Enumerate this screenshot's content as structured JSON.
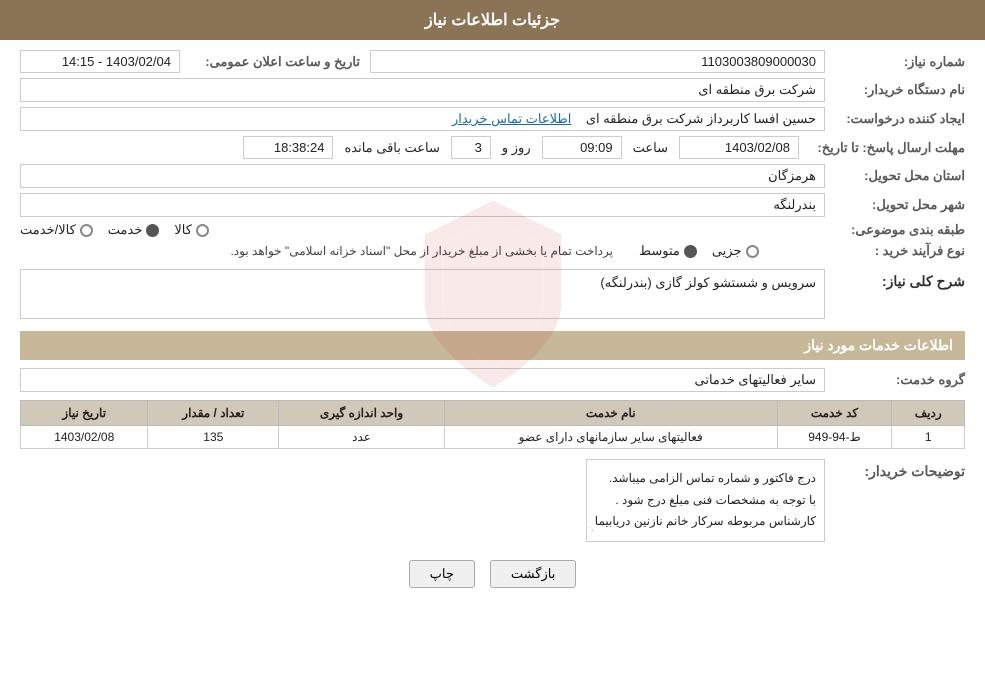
{
  "header": {
    "title": "جزئیات اطلاعات نیاز"
  },
  "fields": {
    "need_number_label": "شماره نیاز:",
    "need_number_value": "1103003809000030",
    "buyer_org_label": "نام دستگاه خریدار:",
    "buyer_org_value": "شرکت برق منطقه ای",
    "creator_label": "ایجاد کننده درخواست:",
    "creator_value": "حسین افسا کاربرداز شرکت برق منطقه ای",
    "creator_link": "اطلاعات تماس خریدار",
    "response_deadline_label": "مهلت ارسال پاسخ: تا تاریخ:",
    "response_date": "1403/02/08",
    "response_time_label": "ساعت",
    "response_time": "09:09",
    "response_days_label": "روز و",
    "response_days": "3",
    "response_remaining_label": "ساعت باقی مانده",
    "response_remaining": "18:38:24",
    "province_label": "استان محل تحویل:",
    "province_value": "هرمزگان",
    "city_label": "شهر محل تحویل:",
    "city_value": "بندرلنگه",
    "category_label": "طبقه بندی موضوعی:",
    "category_options": [
      "کالا",
      "خدمت",
      "کالا/خدمت"
    ],
    "category_selected": "خدمت",
    "process_label": "نوع فرآیند خرید :",
    "process_options": [
      "جزیی",
      "متوسط"
    ],
    "process_note": "پرداخت تمام یا بخشی از مبلغ خریدار از محل \"اسناد خزانه اسلامی\" خواهد بود.",
    "public_announce_label": "تاریخ و ساعت اعلان عمومی:",
    "public_announce_value": "1403/02/04 - 14:15"
  },
  "need_description": {
    "section_title": "شرح کلی نیاز:",
    "value": "سرویس و شستشو کولز گازی (بندرلنگه)"
  },
  "services_section": {
    "title": "اطلاعات خدمات مورد نیاز",
    "service_group_label": "گروه خدمت:",
    "service_group_value": "سایر فعالیتهای خدماتی"
  },
  "table": {
    "columns": [
      "ردیف",
      "کد خدمت",
      "نام خدمت",
      "واحد اندازه گیری",
      "تعداد / مقدار",
      "تاریخ نیاز"
    ],
    "rows": [
      {
        "row": "1",
        "code": "ط-94-949",
        "name": "فعالیتهای سایر سازمانهای دارای عضو",
        "unit": "عدد",
        "quantity": "135",
        "date": "1403/02/08"
      }
    ]
  },
  "buyer_description": {
    "label": "توضیحات خریدار:",
    "lines": [
      "درج فاکتور و شماره تماس الزامی میباشد.",
      "با توجه به مشخصات فنی مبلغ درج شود .",
      "کارشناس مربوطه سرکار خانم نازنین دریابیما"
    ]
  },
  "buttons": {
    "back": "بازگشت",
    "print": "چاپ"
  }
}
